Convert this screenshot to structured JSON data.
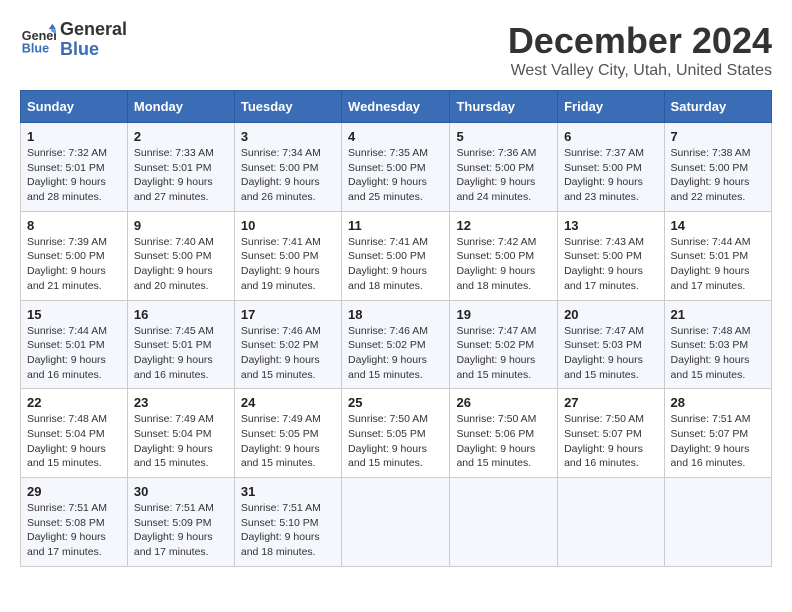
{
  "logo": {
    "line1": "General",
    "line2": "Blue"
  },
  "title": "December 2024",
  "subtitle": "West Valley City, Utah, United States",
  "headers": [
    "Sunday",
    "Monday",
    "Tuesday",
    "Wednesday",
    "Thursday",
    "Friday",
    "Saturday"
  ],
  "weeks": [
    [
      {
        "day": "1",
        "sunrise": "7:32 AM",
        "sunset": "5:01 PM",
        "daylight": "9 hours and 28 minutes."
      },
      {
        "day": "2",
        "sunrise": "7:33 AM",
        "sunset": "5:01 PM",
        "daylight": "9 hours and 27 minutes."
      },
      {
        "day": "3",
        "sunrise": "7:34 AM",
        "sunset": "5:00 PM",
        "daylight": "9 hours and 26 minutes."
      },
      {
        "day": "4",
        "sunrise": "7:35 AM",
        "sunset": "5:00 PM",
        "daylight": "9 hours and 25 minutes."
      },
      {
        "day": "5",
        "sunrise": "7:36 AM",
        "sunset": "5:00 PM",
        "daylight": "9 hours and 24 minutes."
      },
      {
        "day": "6",
        "sunrise": "7:37 AM",
        "sunset": "5:00 PM",
        "daylight": "9 hours and 23 minutes."
      },
      {
        "day": "7",
        "sunrise": "7:38 AM",
        "sunset": "5:00 PM",
        "daylight": "9 hours and 22 minutes."
      }
    ],
    [
      {
        "day": "8",
        "sunrise": "7:39 AM",
        "sunset": "5:00 PM",
        "daylight": "9 hours and 21 minutes."
      },
      {
        "day": "9",
        "sunrise": "7:40 AM",
        "sunset": "5:00 PM",
        "daylight": "9 hours and 20 minutes."
      },
      {
        "day": "10",
        "sunrise": "7:41 AM",
        "sunset": "5:00 PM",
        "daylight": "9 hours and 19 minutes."
      },
      {
        "day": "11",
        "sunrise": "7:41 AM",
        "sunset": "5:00 PM",
        "daylight": "9 hours and 18 minutes."
      },
      {
        "day": "12",
        "sunrise": "7:42 AM",
        "sunset": "5:00 PM",
        "daylight": "9 hours and 18 minutes."
      },
      {
        "day": "13",
        "sunrise": "7:43 AM",
        "sunset": "5:00 PM",
        "daylight": "9 hours and 17 minutes."
      },
      {
        "day": "14",
        "sunrise": "7:44 AM",
        "sunset": "5:01 PM",
        "daylight": "9 hours and 17 minutes."
      }
    ],
    [
      {
        "day": "15",
        "sunrise": "7:44 AM",
        "sunset": "5:01 PM",
        "daylight": "9 hours and 16 minutes."
      },
      {
        "day": "16",
        "sunrise": "7:45 AM",
        "sunset": "5:01 PM",
        "daylight": "9 hours and 16 minutes."
      },
      {
        "day": "17",
        "sunrise": "7:46 AM",
        "sunset": "5:02 PM",
        "daylight": "9 hours and 15 minutes."
      },
      {
        "day": "18",
        "sunrise": "7:46 AM",
        "sunset": "5:02 PM",
        "daylight": "9 hours and 15 minutes."
      },
      {
        "day": "19",
        "sunrise": "7:47 AM",
        "sunset": "5:02 PM",
        "daylight": "9 hours and 15 minutes."
      },
      {
        "day": "20",
        "sunrise": "7:47 AM",
        "sunset": "5:03 PM",
        "daylight": "9 hours and 15 minutes."
      },
      {
        "day": "21",
        "sunrise": "7:48 AM",
        "sunset": "5:03 PM",
        "daylight": "9 hours and 15 minutes."
      }
    ],
    [
      {
        "day": "22",
        "sunrise": "7:48 AM",
        "sunset": "5:04 PM",
        "daylight": "9 hours and 15 minutes."
      },
      {
        "day": "23",
        "sunrise": "7:49 AM",
        "sunset": "5:04 PM",
        "daylight": "9 hours and 15 minutes."
      },
      {
        "day": "24",
        "sunrise": "7:49 AM",
        "sunset": "5:05 PM",
        "daylight": "9 hours and 15 minutes."
      },
      {
        "day": "25",
        "sunrise": "7:50 AM",
        "sunset": "5:05 PM",
        "daylight": "9 hours and 15 minutes."
      },
      {
        "day": "26",
        "sunrise": "7:50 AM",
        "sunset": "5:06 PM",
        "daylight": "9 hours and 15 minutes."
      },
      {
        "day": "27",
        "sunrise": "7:50 AM",
        "sunset": "5:07 PM",
        "daylight": "9 hours and 16 minutes."
      },
      {
        "day": "28",
        "sunrise": "7:51 AM",
        "sunset": "5:07 PM",
        "daylight": "9 hours and 16 minutes."
      }
    ],
    [
      {
        "day": "29",
        "sunrise": "7:51 AM",
        "sunset": "5:08 PM",
        "daylight": "9 hours and 17 minutes."
      },
      {
        "day": "30",
        "sunrise": "7:51 AM",
        "sunset": "5:09 PM",
        "daylight": "9 hours and 17 minutes."
      },
      {
        "day": "31",
        "sunrise": "7:51 AM",
        "sunset": "5:10 PM",
        "daylight": "9 hours and 18 minutes."
      },
      null,
      null,
      null,
      null
    ]
  ],
  "labels": {
    "sunrise": "Sunrise:",
    "sunset": "Sunset:",
    "daylight": "Daylight:"
  }
}
